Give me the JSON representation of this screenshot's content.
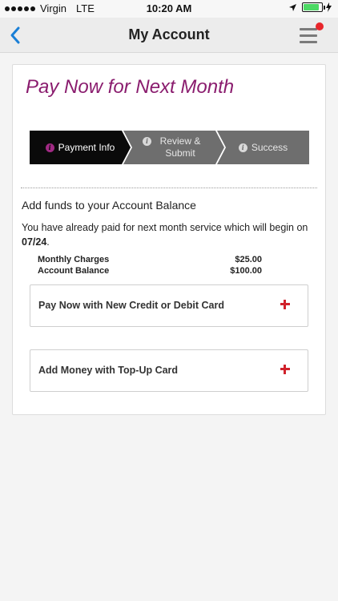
{
  "status_bar": {
    "carrier": "Virgin",
    "network": "LTE",
    "time": "10:20 AM",
    "battery_level": 0.85,
    "icons": [
      "signal-dots-icon",
      "location-arrow-icon",
      "battery-icon",
      "charging-bolt-icon"
    ]
  },
  "nav": {
    "title": "My Account",
    "back_icon": "chevron-left-icon",
    "menu_icon": "hamburger-menu-icon",
    "notification_color": "#e8262b",
    "accent_color": "#1a7fd6"
  },
  "page": {
    "title": "Pay Now for Next Month",
    "title_color": "#8a1c6e"
  },
  "stepper": {
    "steps": [
      {
        "label": "Payment Info",
        "active": true
      },
      {
        "label": "Review & Submit",
        "active": false
      },
      {
        "label": "Success",
        "active": false
      }
    ]
  },
  "balance": {
    "heading": "Add funds to your Account Balance",
    "note": "You have already paid for next month service which will begin on",
    "start_date": "07/24",
    "charges": [
      {
        "label": "Monthly Charges",
        "amount": "$25.00"
      },
      {
        "label": "Account Balance",
        "amount": "$100.00"
      }
    ]
  },
  "actions": [
    {
      "label": "Pay Now with New Credit or Debit Card",
      "icon": "plus-icon"
    },
    {
      "label": "Add Money with Top-Up Card",
      "icon": "plus-icon"
    }
  ]
}
